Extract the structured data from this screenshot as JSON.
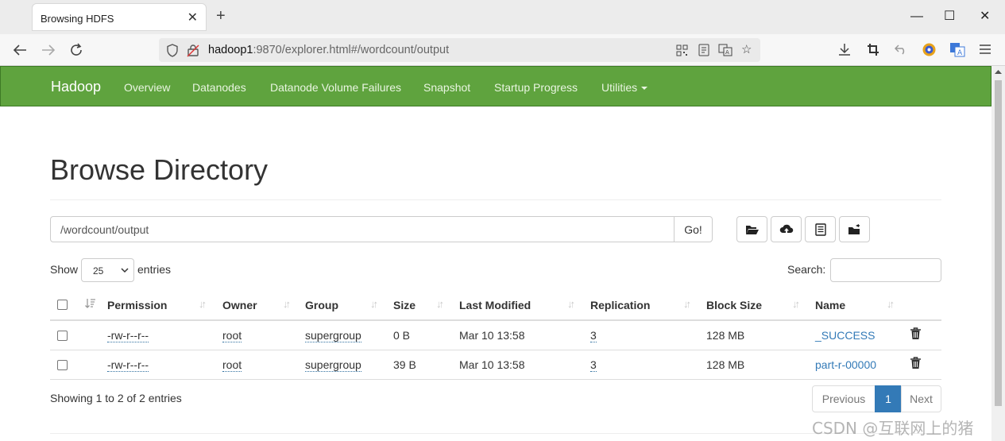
{
  "browser": {
    "tab_title": "Browsing HDFS",
    "tab_close": "✕",
    "new_tab": "+",
    "url_host": "hadoop1",
    "url_rest": ":9870/explorer.html#/wordcount/output",
    "win_min": "—",
    "win_max": "☐",
    "win_close": "✕"
  },
  "navbar": {
    "brand": "Hadoop",
    "links": [
      "Overview",
      "Datanodes",
      "Datanode Volume Failures",
      "Snapshot",
      "Startup Progress",
      "Utilities"
    ]
  },
  "page": {
    "title": "Browse Directory",
    "path_value": "/wordcount/output",
    "go_label": "Go!"
  },
  "table_controls": {
    "show_label": "Show",
    "entries_value": "25",
    "entries_label": "entries",
    "search_label": "Search:"
  },
  "table": {
    "columns": [
      "Permission",
      "Owner",
      "Group",
      "Size",
      "Last Modified",
      "Replication",
      "Block Size",
      "Name"
    ],
    "rows": [
      {
        "permission": "-rw-r--r--",
        "owner": "root",
        "group": "supergroup",
        "size": "0 B",
        "modified": "Mar 10 13:58",
        "replication": "3",
        "block_size": "128 MB",
        "name": "_SUCCESS"
      },
      {
        "permission": "-rw-r--r--",
        "owner": "root",
        "group": "supergroup",
        "size": "39 B",
        "modified": "Mar 10 13:58",
        "replication": "3",
        "block_size": "128 MB",
        "name": "part-r-00000"
      }
    ]
  },
  "footer": {
    "info": "Showing 1 to 2 of 2 entries",
    "prev": "Previous",
    "page": "1",
    "next": "Next"
  },
  "watermark": "CSDN @互联网上的猪",
  "colors": {
    "navbar": "#5fa33e",
    "link": "#337ab7",
    "active_page": "#337ab7"
  }
}
